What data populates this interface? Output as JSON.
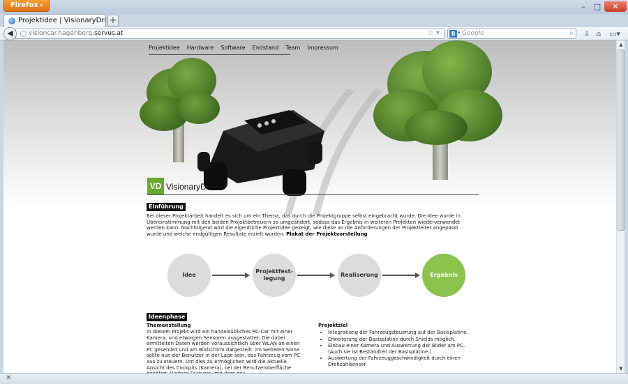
{
  "browser": {
    "menu_label": "Firefox",
    "menu_arrow": "▾",
    "tab_title": "Projektidee | VisionaryDrive | Pr...",
    "tab_close": "×",
    "new_tab": "+",
    "url_prefix": "visioncar.hagenberg.",
    "url_domain": "servus.at",
    "search_placeholder": "Google",
    "search_engine_letter": "8",
    "window_controls": {
      "minimize": "–",
      "maximize": "□",
      "close": "✕"
    }
  },
  "site": {
    "nav": [
      "Projektidee",
      "Hardware",
      "Software",
      "Endstand",
      "Team",
      "Impressum"
    ],
    "logo_text": "VD",
    "brand": "VisionaryDrive",
    "intro": {
      "heading": "Einführung",
      "text": "Bei dieser Projektarbeit handelt es sich um ein Thema, das durch die Projektgruppe selbst eingebracht wurde. Die Idee wurde in Übereinstimmung mit den beiden Projektbetreuern so umgeändert, sodass das Ergebnis in weiteren Projekten wiederverwendet werden kann. Nachfolgend wird die eigentliche Projektidee gezeigt, wie diese an die Anforderungen der Projektleiter angepasst wurde und welche endgültigen Resultate erzielt wurden.",
      "link": "Plakat der Projektvorstellung"
    },
    "process": [
      {
        "label": "Idee"
      },
      {
        "label": "Projektfest-\nlegung"
      },
      {
        "label": "Realiserung"
      },
      {
        "label": "Ergebnis"
      }
    ],
    "ideas": {
      "heading": "Ideenphase",
      "left_title": "Themenstellung",
      "left_text": "In diesem Projekt wird ein handelsübliches RC-Car mit einer Kamera, und etwaigen Sensoren ausgestattet. Die dabei ermittelten Daten werden voraussichtlich über WLAN an einen PC gesendet und am Bildschirm dargestellt. Im weiteren Sinne sollte nun der Benutzer in der Lage sein, das Fahrzeug vom PC aus zu steuern. Um dies zu ermöglichen wird die aktuelle Ansicht des Cockpits (Kamera), bei der Benutzeroberfläche benötigt. Weitere Features, mit dem das",
      "right_title": "Projektziel",
      "goals": [
        "Integrationg der Fahrzeugsteuerung auf der Basisplatine.",
        "Erweiterung der Basisplatine durch Shields möglich.",
        "Einbau einer Kamera und Auswertung der Bilder am PC. (Auch sie ist Bestandteil der Basisplatine.)",
        "Auswertung der Fahrzeuggeschwindigkeit durch einen Drehzahlsensor."
      ]
    }
  },
  "colors": {
    "accent": "#8cc34f",
    "logo": "#6aaa2e",
    "firefox": "#e8821f"
  }
}
